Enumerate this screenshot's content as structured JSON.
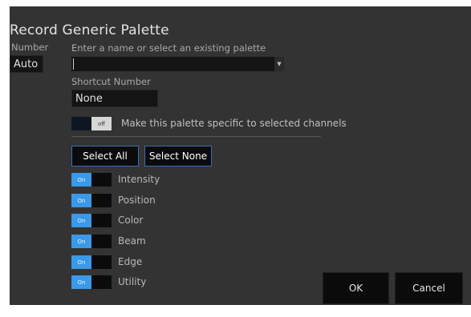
{
  "dialog": {
    "title": "Record Generic Palette",
    "number_label": "Number",
    "number_value": "Auto",
    "name_prompt": "Enter a name or select an existing palette",
    "name_value": "",
    "shortcut_label": "Shortcut Number",
    "shortcut_value": "None",
    "specific_toggle": {
      "state_label": "off",
      "label": "Make this palette specific to selected channels"
    },
    "select_all_label": "Select All",
    "select_none_label": "Select None",
    "categories": [
      {
        "label": "Intensity",
        "state_label": "On"
      },
      {
        "label": "Position",
        "state_label": "On"
      },
      {
        "label": "Color",
        "state_label": "On"
      },
      {
        "label": "Beam",
        "state_label": "On"
      },
      {
        "label": "Edge",
        "state_label": "On"
      },
      {
        "label": "Utility",
        "state_label": "On"
      }
    ],
    "ok_label": "OK",
    "cancel_label": "Cancel"
  },
  "colors": {
    "accent": "#3a99e8",
    "button_border": "#3e6bb6",
    "background": "#333333"
  }
}
